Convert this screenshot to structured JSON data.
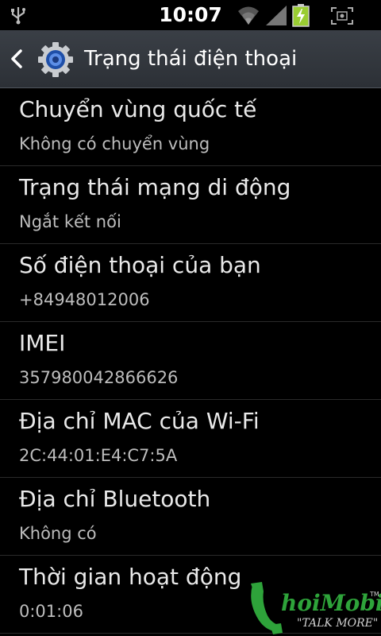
{
  "status_bar": {
    "time": "10:07",
    "icons": [
      "usb-icon",
      "wifi-icon",
      "signal-icon",
      "battery-charging-icon",
      "screenshot-icon"
    ]
  },
  "action_bar": {
    "title": "Trạng thái điện thoại",
    "icons": [
      "back-icon",
      "settings-gear-icon"
    ]
  },
  "items": [
    {
      "title": "Chuyển vùng quốc tế",
      "summary": "Không có chuyển vùng"
    },
    {
      "title": "Trạng thái mạng di động",
      "summary": "Ngắt kết nối"
    },
    {
      "title": "Số điện thoại của bạn",
      "summary": "+84948012006"
    },
    {
      "title": "IMEI",
      "summary": "357980042866626"
    },
    {
      "title": "Địa chỉ MAC của Wi-Fi",
      "summary": "2C:44:01:E4:C7:5A"
    },
    {
      "title": "Địa chỉ Bluetooth",
      "summary": "Không có"
    },
    {
      "title": "Thời gian hoạt động",
      "summary": "0:01:06"
    }
  ],
  "watermark": {
    "brand": "hoiMobile",
    "tagline": "\"TALK MORE\"",
    "tm": "TM"
  },
  "colors": {
    "background": "#000000",
    "actionbar": "#33383e",
    "battery": "#9acd32",
    "watermark_green": "#2ea33a"
  }
}
